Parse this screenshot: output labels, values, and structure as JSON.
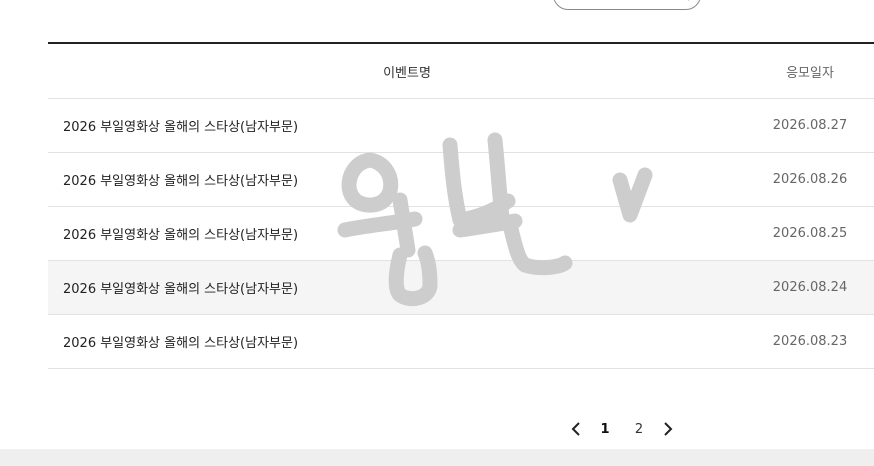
{
  "table": {
    "header": {
      "event_name": "이벤트명",
      "entry_date": "응모일자"
    },
    "rows": [
      {
        "event_name": "2026 부일영화상 올해의 스타상(남자부문)",
        "entry_date": "2026.08.27"
      },
      {
        "event_name": "2026 부일영화상 올해의 스타상(남자부문)",
        "entry_date": "2026.08.26"
      },
      {
        "event_name": "2026 부일영화상 올해의 스타상(남자부문)",
        "entry_date": "2026.08.25"
      },
      {
        "event_name": "2026 부일영화상 올해의 스타상(남자부문)",
        "entry_date": "2026.08.24"
      },
      {
        "event_name": "2026 부일영화상 올해의 스타상(남자부문)",
        "entry_date": "2026.08.23"
      }
    ]
  },
  "pagination": {
    "prev_icon": "chevron-left-icon",
    "next_icon": "chevron-right-icon",
    "pages": [
      "1",
      "2"
    ],
    "current": "1"
  },
  "search": {
    "icon": "search-icon"
  },
  "watermark": {
    "kind": "handwritten-scribble",
    "color": "#cdcdcd"
  },
  "colors": {
    "border_dark": "#222222",
    "row_highlight": "#f5f5f5",
    "footer": "#efefef"
  }
}
